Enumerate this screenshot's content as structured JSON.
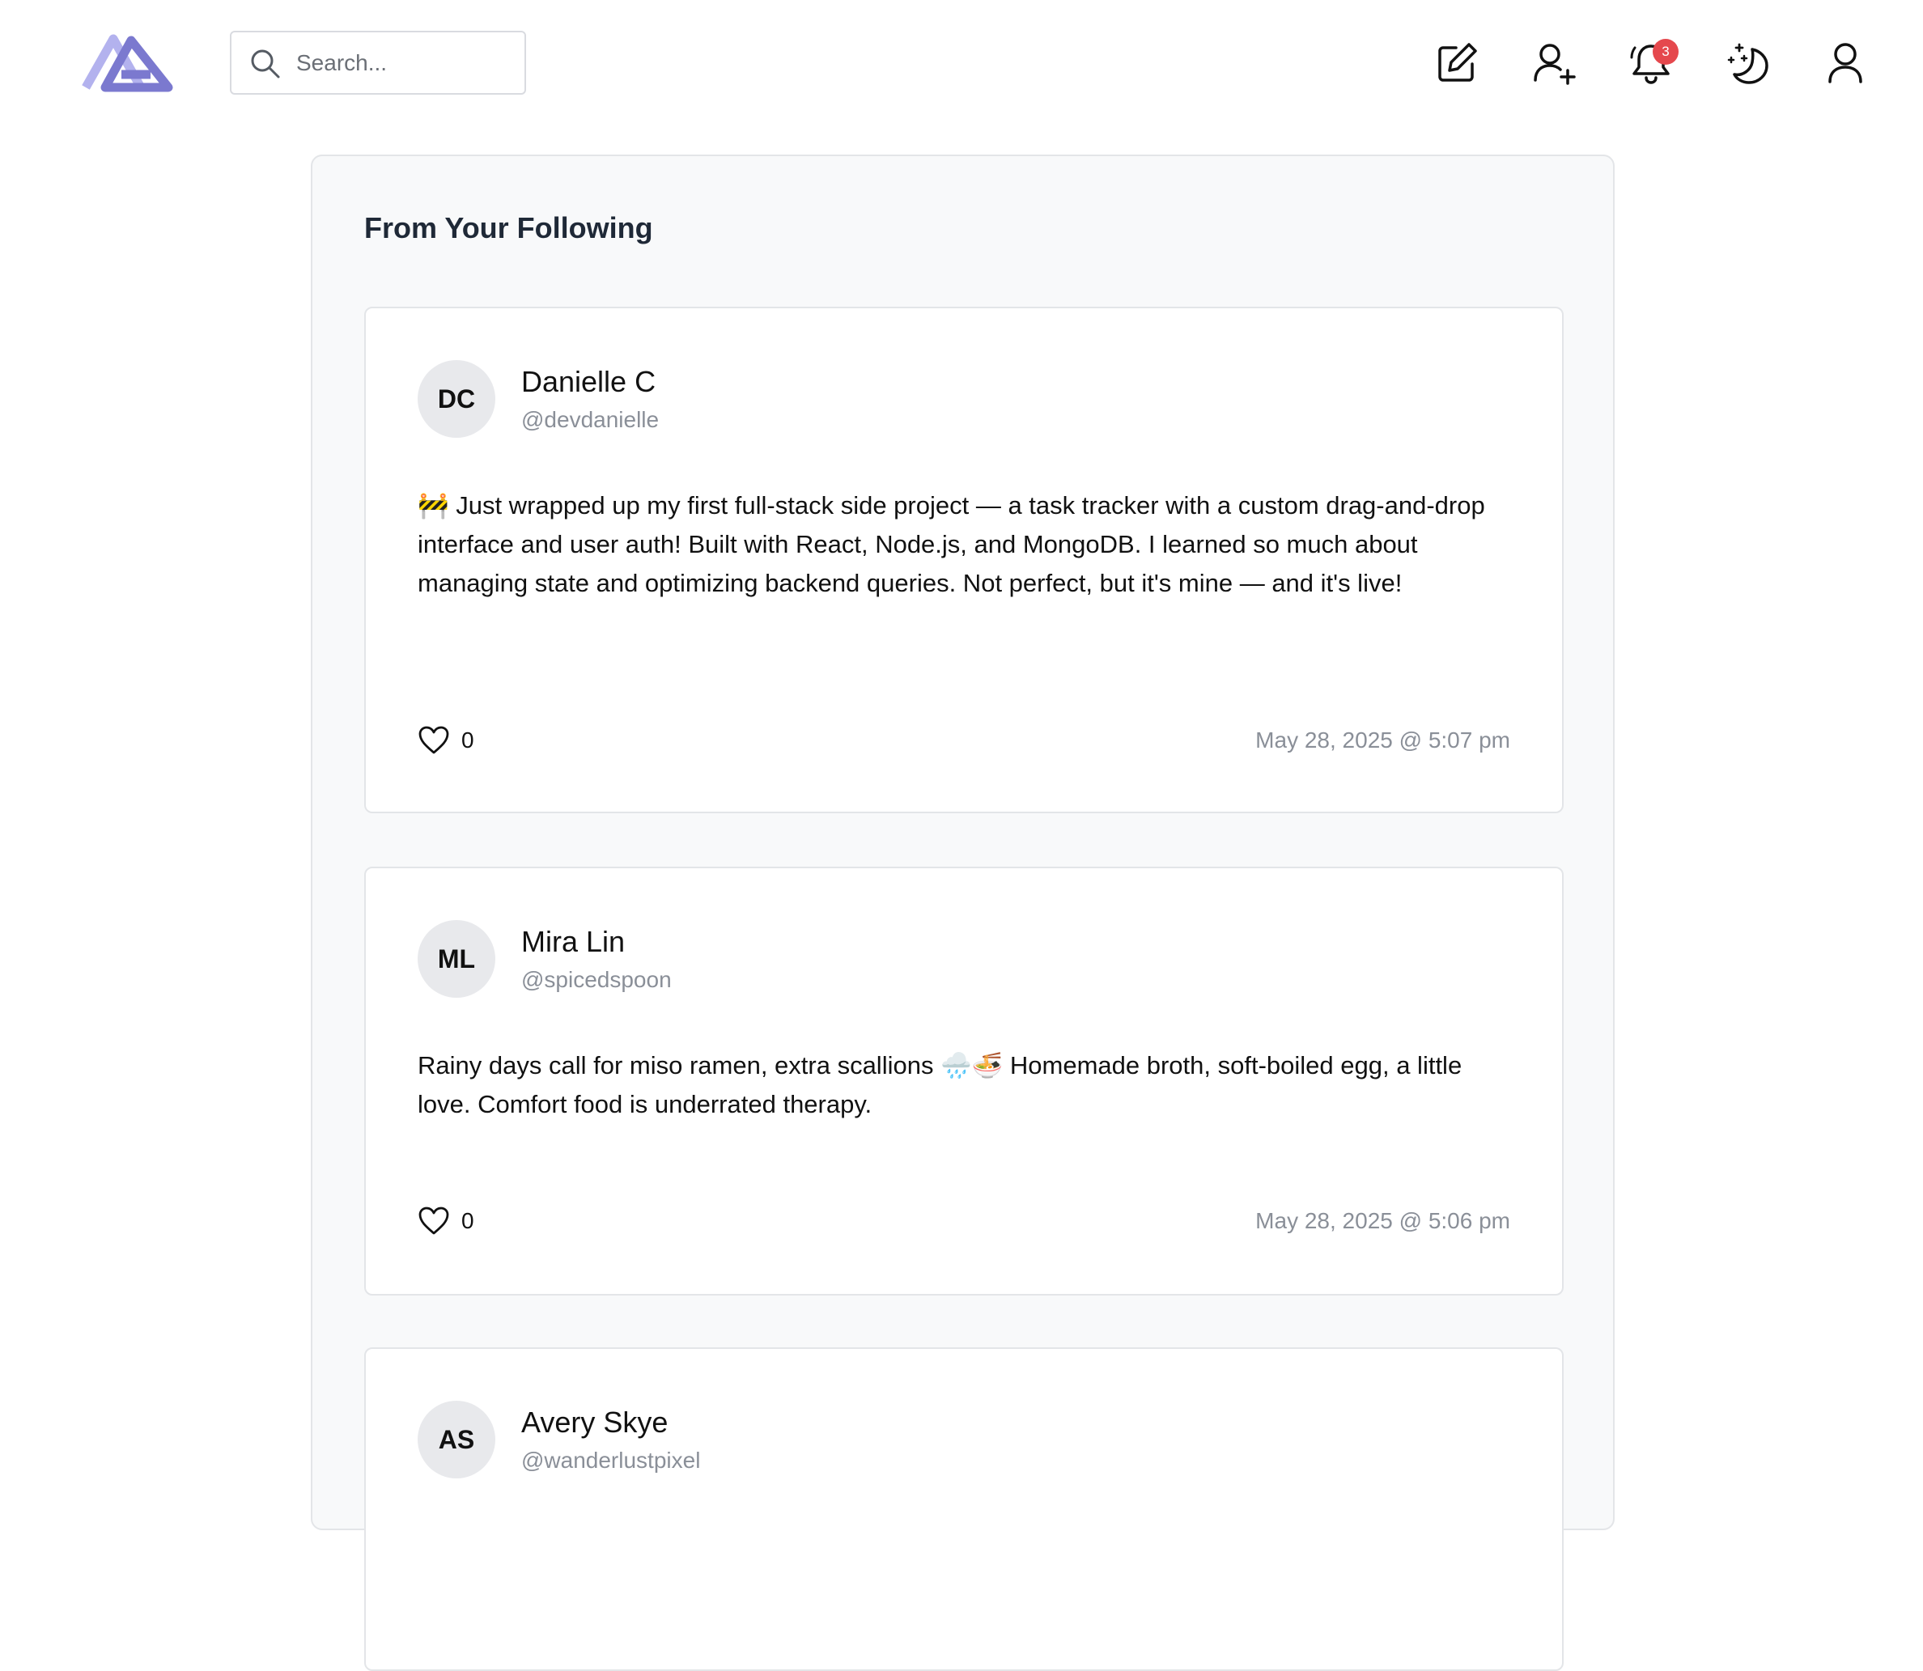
{
  "header": {
    "search_placeholder": "Search...",
    "notification_count": "3",
    "icons": [
      "logo-icon",
      "search-icon",
      "compose-icon",
      "add-friend-icon",
      "bell-icon",
      "moon-stars-icon",
      "profile-icon"
    ]
  },
  "feed": {
    "title": "From Your Following",
    "posts": [
      {
        "initials": "DC",
        "name": "Danielle C",
        "handle": "@devdanielle",
        "body": "🚧 Just wrapped up my first full-stack side project — a task tracker with a custom drag-and-drop interface and user auth! Built with React, Node.js, and MongoDB. I learned so much about managing state and optimizing backend queries. Not perfect, but it's mine — and it's live!",
        "likes": "0",
        "timestamp": "May 28, 2025 @ 5:07 pm"
      },
      {
        "initials": "ML",
        "name": "Mira Lin",
        "handle": "@spicedspoon",
        "body": "Rainy days call for miso ramen, extra scallions 🌧️🍜 Homemade broth, soft-boiled egg, a little love. Comfort food is underrated therapy.",
        "likes": "0",
        "timestamp": "May 28, 2025 @ 5:06 pm"
      },
      {
        "initials": "AS",
        "name": "Avery Skye",
        "handle": "@wanderlustpixel"
      }
    ]
  },
  "colors": {
    "logo_light": "#b3b2ee",
    "logo_dark": "#7b79cf",
    "badge": "#e5484d",
    "muted_text": "#8a8f98",
    "feed_background": "#f8f9fa"
  }
}
